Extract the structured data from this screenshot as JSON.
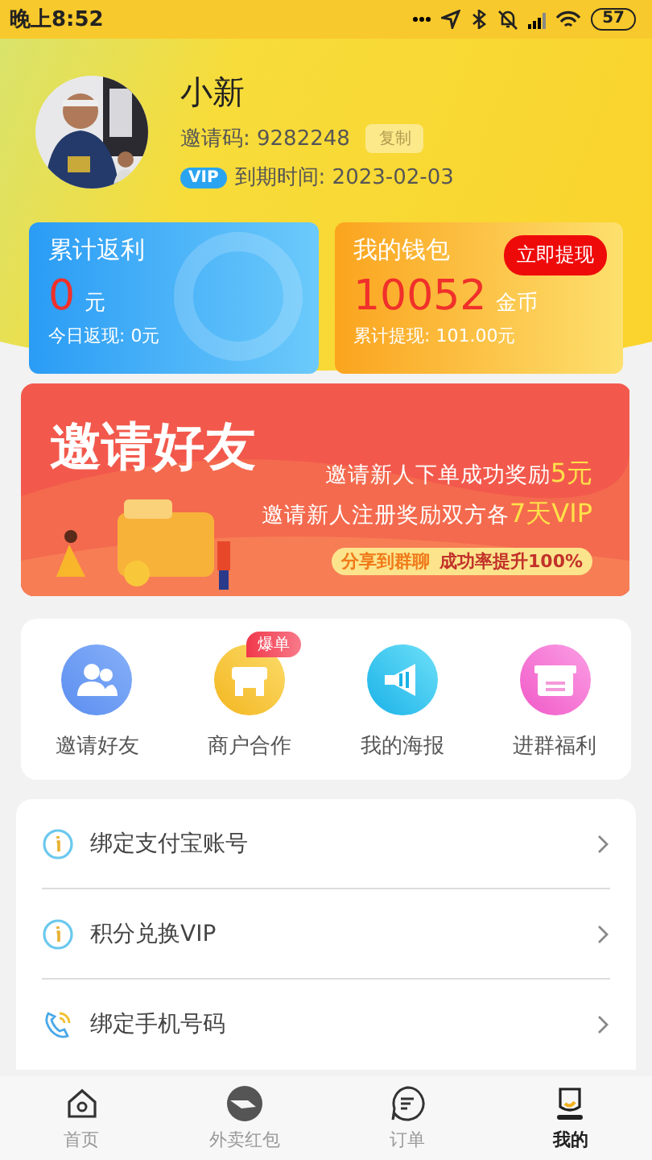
{
  "status_bar": {
    "time": "晚上8:52",
    "battery": "57"
  },
  "profile": {
    "name": "小新",
    "invite_code": "邀请码: 9282248",
    "copy_button": "复制",
    "vip_badge": "VIP",
    "expiry": "到期时间: 2023-02-03"
  },
  "cards": [
    {
      "kind": "rebate",
      "title": "累计返利",
      "amount": "0",
      "unit": "元",
      "note": "今日返现: 0元"
    },
    {
      "kind": "wallet",
      "title": "我的钱包",
      "button": "立即提现",
      "amount": "10052",
      "unit": "金币",
      "note": "累计提现: 101.00元"
    }
  ],
  "banner": {
    "title": "邀请好友",
    "lines": [
      {
        "text": "邀请新人下单成功奖励",
        "reward": "5元"
      },
      {
        "text": "邀请新人注册奖励双方各",
        "reward": "7天VIP"
      }
    ],
    "share": "分享到群聊",
    "rate": "成功率提升100%"
  },
  "features": [
    {
      "label": "邀请好友"
    },
    {
      "label": "商户合作",
      "badge": "爆单"
    },
    {
      "label": "我的海报"
    },
    {
      "label": "进群福利"
    }
  ],
  "menu": [
    {
      "label": "绑定支付宝账号"
    },
    {
      "label": "积分兑换VIP"
    },
    {
      "label": "绑定手机号码"
    }
  ],
  "tab_bar": [
    {
      "label": "首页",
      "selected": false
    },
    {
      "label": "外卖红包",
      "selected": false
    },
    {
      "label": "订单",
      "selected": false
    },
    {
      "label": "我的",
      "selected": true
    }
  ]
}
